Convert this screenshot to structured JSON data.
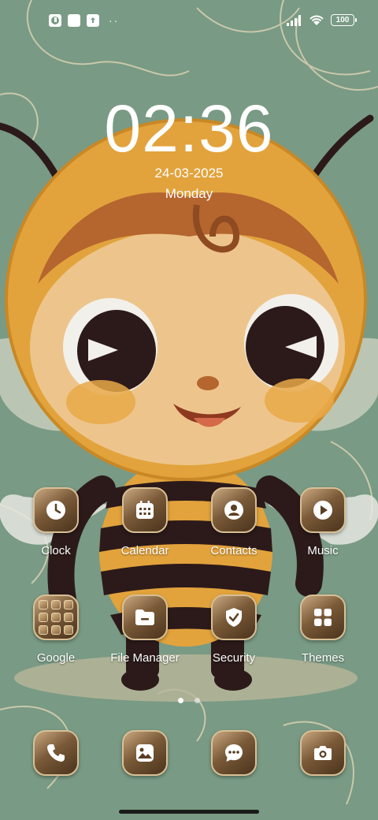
{
  "status_bar": {
    "left_icons": [
      "app-notification-icon",
      "square-notification-icon",
      "upload-icon"
    ],
    "more_dots": "··",
    "battery_level": "100",
    "signal_icon": "cellular-signal-icon",
    "wifi_icon": "wifi-icon"
  },
  "lockclock": {
    "time": "02:36",
    "date": "24-03-2025",
    "day": "Monday"
  },
  "apps": {
    "clock": {
      "label": "Clock",
      "icon": "clock-icon"
    },
    "calendar": {
      "label": "Calendar",
      "icon": "calendar-icon"
    },
    "contacts": {
      "label": "Contacts",
      "icon": "contacts-icon"
    },
    "music": {
      "label": "Music",
      "icon": "play-icon"
    },
    "google": {
      "label": "Google",
      "icon": "google-folder-icon"
    },
    "file_manager": {
      "label": "File Manager",
      "icon": "folder-icon"
    },
    "security": {
      "label": "Security",
      "icon": "shield-check-icon"
    },
    "themes": {
      "label": "Themes",
      "icon": "themes-grid-icon"
    }
  },
  "dock": [
    "phone-icon",
    "gallery-icon",
    "messages-icon",
    "camera-icon"
  ],
  "page_indicator": {
    "pages": 2,
    "current": 1
  },
  "colors": {
    "background": "#799a84",
    "icon_gradient_light": "#c9a880",
    "icon_gradient_dark": "#4a331c",
    "bee_orange": "#e2a33c",
    "bee_dark": "#2c1a1a"
  }
}
